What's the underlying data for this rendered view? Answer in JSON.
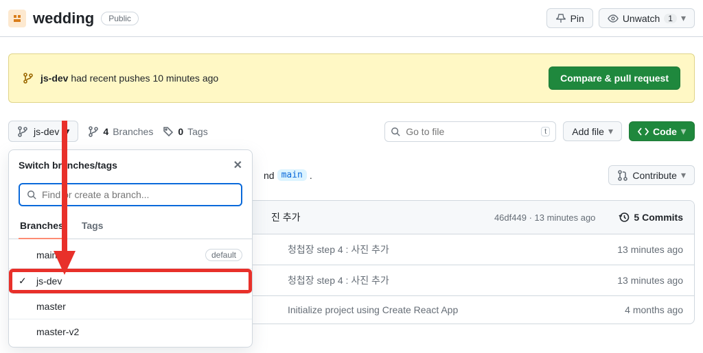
{
  "header": {
    "repo_name": "wedding",
    "visibility": "Public",
    "pin_label": "Pin",
    "unwatch_label": "Unwatch",
    "unwatch_count": "1"
  },
  "alert": {
    "branch": "js-dev",
    "message": " had recent pushes 10 minutes ago",
    "button": "Compare & pull request"
  },
  "toolbar": {
    "current_branch": "js-dev",
    "branches_count": "4",
    "branches_label": "Branches",
    "tags_count": "0",
    "tags_label": "Tags",
    "search_placeholder": "Go to file",
    "search_kbd": "t",
    "add_file": "Add file",
    "code_label": "Code"
  },
  "compare": {
    "prefix_text": "nd ",
    "chip": "main",
    "suffix": ".",
    "contribute": "Contribute"
  },
  "commits": {
    "head_title": "진 추가",
    "hash": "46df449",
    "sep": " · ",
    "time": "13 minutes ago",
    "count": "5 Commits",
    "rows": [
      {
        "msg": "청첩장 step 4 : 사진 추가",
        "time": "13 minutes ago"
      },
      {
        "msg": "청첩장 step 4 : 사진 추가",
        "time": "13 minutes ago"
      },
      {
        "msg": "Initialize project using Create React App",
        "time": "4 months ago"
      }
    ]
  },
  "dropdown": {
    "title": "Switch branches/tags",
    "search_placeholder": "Find or create a branch...",
    "tabs": {
      "branches": "Branches",
      "tags": "Tags"
    },
    "default_label": "default",
    "items": [
      {
        "name": "main",
        "default": true,
        "checked": false
      },
      {
        "name": "js-dev",
        "default": false,
        "checked": true
      },
      {
        "name": "master",
        "default": false,
        "checked": false
      },
      {
        "name": "master-v2",
        "default": false,
        "checked": false
      }
    ]
  }
}
